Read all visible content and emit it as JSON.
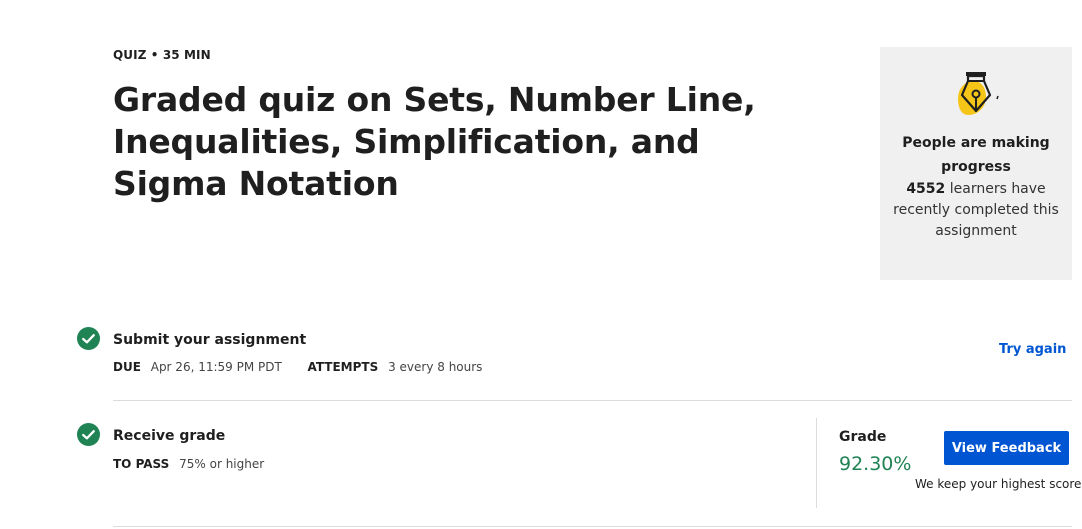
{
  "header": {
    "meta": "QUIZ • 35 MIN",
    "title": "Graded quiz on Sets, Number Line, Inequalities, Simplification, and Sigma Notation"
  },
  "progress_card": {
    "icon": "pen-nib-icon",
    "heading": "People are making progress",
    "count": "4552",
    "text": "learners have recently completed this assignment"
  },
  "submit": {
    "title": "Submit your assignment",
    "due_label": "DUE",
    "due_value": "Apr 26, 11:59 PM PDT",
    "attempts_label": "ATTEMPTS",
    "attempts_value": "3 every 8 hours",
    "try_again": "Try again"
  },
  "grade": {
    "title": "Receive grade",
    "to_pass_label": "TO PASS",
    "to_pass_value": "75% or higher",
    "grade_label": "Grade",
    "grade_value": "92.30%",
    "view_feedback": "View Feedback",
    "note": "We keep your highest score"
  },
  "colors": {
    "accent": "#0056d2",
    "success": "#1f8354",
    "card_bg": "#f0f0f0",
    "highlight": "#f5c518"
  }
}
